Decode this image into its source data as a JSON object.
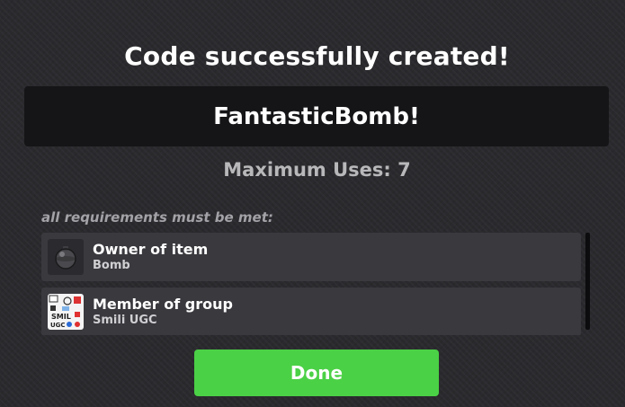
{
  "dialog": {
    "title": "Code successfully created!",
    "code": "FantasticBomb!",
    "max_uses": "Maximum Uses: 7",
    "requirements_heading": "all requirements must be met:",
    "requirements": [
      {
        "title": "Owner of item",
        "subtitle": "Bomb",
        "icon": "bomb-icon"
      },
      {
        "title": "Member of group",
        "subtitle": "Smili UGC",
        "icon": "group-logo-icon"
      }
    ],
    "done_label": "Done"
  },
  "colors": {
    "background": "#2a2a2e",
    "code_box": "#151518",
    "item_background": "#39393e",
    "done_button": "#4bd146",
    "muted_text": "#b8b8bb"
  }
}
